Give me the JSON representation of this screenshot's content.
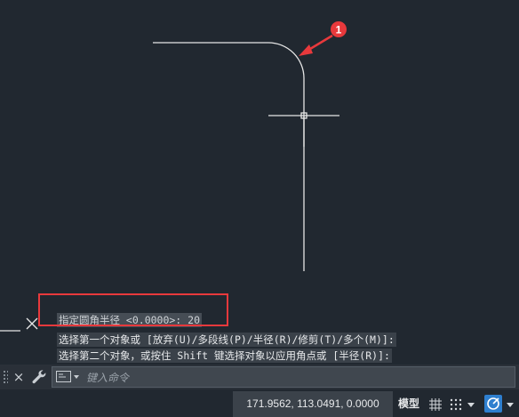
{
  "canvas": {
    "callout_number": "1",
    "callout_color": "#e8393c",
    "bg_color": "#212830",
    "geometry_color": "#e6e6e6"
  },
  "command_history": [
    "指定圆角半径 <0.0000>: 20",
    "选择第一个对象或 [放弃(U)/多段线(P)/半径(R)/修剪(T)/多个(M)]:",
    "选择第二个对象，或按住 Shift 键选择对象以应用角点或 [半径(R)]:"
  ],
  "command_bar": {
    "close_icon": "×",
    "input_placeholder": "键入命令"
  },
  "status_bar": {
    "coordinates": "171.9562, 113.0491, 0.0000",
    "model_label": "模型"
  }
}
